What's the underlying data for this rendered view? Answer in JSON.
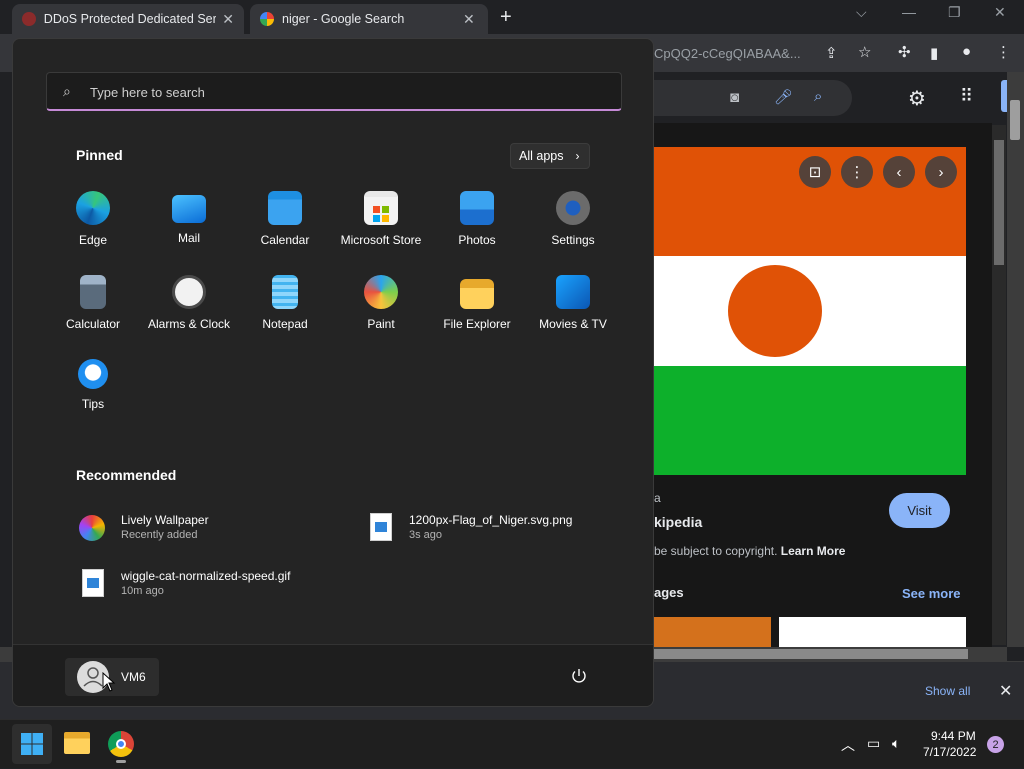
{
  "browser": {
    "tabs": [
      {
        "title": "DDoS Protected Dedicated Serve",
        "close": "✕"
      },
      {
        "title": "niger - Google Search",
        "close": "✕"
      }
    ],
    "new_tab": "+",
    "url_fragment": "CpQQ2-cCegQIABAA&...",
    "window_controls": {
      "minimize": "—",
      "restore": "❐",
      "close": "✕",
      "dropdown": "⌵"
    }
  },
  "google": {
    "visit_label": "Visit",
    "source_name": "kipedia",
    "source_prefix": "a",
    "copyright_text": "be subject to copyright.",
    "learn_more": "Learn More",
    "related_label": "ages",
    "see_more": "See more",
    "colors": {
      "flag_orange": "#e05206",
      "flag_white": "#ffffff",
      "flag_green": "#0db02b"
    }
  },
  "downloads": {
    "show_all": "Show all",
    "close": "✕"
  },
  "start_menu": {
    "search_placeholder": "Type here to search",
    "pinned_heading": "Pinned",
    "all_apps_label": "All apps",
    "pinned_apps": [
      {
        "label": "Edge",
        "icon": "edge-icon"
      },
      {
        "label": "Mail",
        "icon": "mail-icon"
      },
      {
        "label": "Calendar",
        "icon": "calendar-icon"
      },
      {
        "label": "Microsoft Store",
        "icon": "store-icon"
      },
      {
        "label": "Photos",
        "icon": "photos-icon"
      },
      {
        "label": "Settings",
        "icon": "settings-icon"
      },
      {
        "label": "Calculator",
        "icon": "calculator-icon"
      },
      {
        "label": "Alarms & Clock",
        "icon": "clock-icon"
      },
      {
        "label": "Notepad",
        "icon": "notepad-icon"
      },
      {
        "label": "Paint",
        "icon": "paint-icon"
      },
      {
        "label": "File Explorer",
        "icon": "folder-icon"
      },
      {
        "label": "Movies & TV",
        "icon": "movies-icon"
      },
      {
        "label": "Tips",
        "icon": "tips-icon"
      }
    ],
    "recommended_heading": "Recommended",
    "recommended": [
      {
        "name": "Lively Wallpaper",
        "sub": "Recently added"
      },
      {
        "name": "1200px-Flag_of_Niger.svg.png",
        "sub": "3s ago"
      },
      {
        "name": "wiggle-cat-normalized-speed.gif",
        "sub": "10m ago"
      }
    ],
    "user_name": "VM6"
  },
  "taskbar": {
    "time": "9:44 PM",
    "date": "7/17/2022",
    "notification_count": "2"
  }
}
